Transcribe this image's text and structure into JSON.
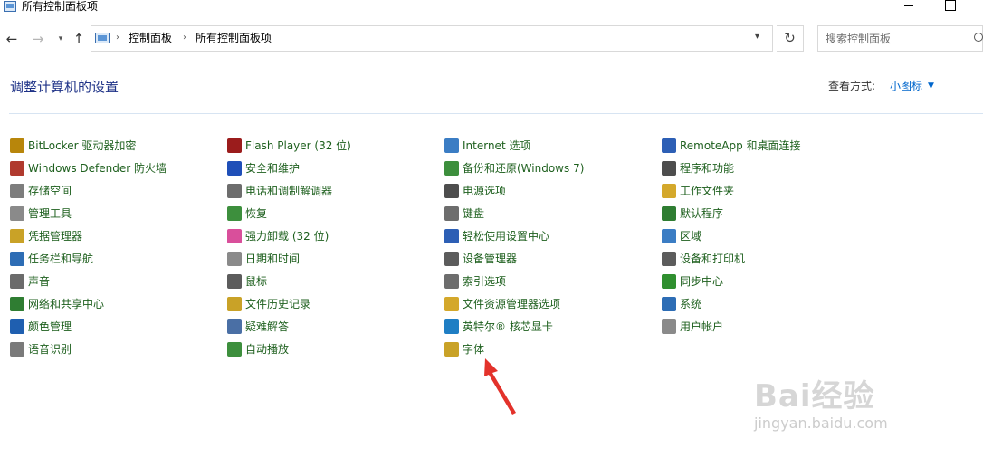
{
  "window": {
    "title": "所有控制面板项"
  },
  "nav": {
    "back": "←",
    "forward": "→",
    "recent": "▾",
    "up": "↑",
    "breadcrumb": [
      "控制面板",
      "所有控制面板项"
    ],
    "refresh": "↻",
    "search_placeholder": "搜索控制面板"
  },
  "header": {
    "title": "调整计算机的设置",
    "view_label": "查看方式:",
    "view_value": "小图标",
    "view_caret": "▼"
  },
  "columns": [
    [
      {
        "label": "BitLocker 驱动器加密",
        "icon": "key-icon",
        "color": "#b8860b"
      },
      {
        "label": "Windows Defender 防火墙",
        "icon": "firewall-icon",
        "color": "#b03a2e"
      },
      {
        "label": "存储空间",
        "icon": "storage-icon",
        "color": "#7d7d7d"
      },
      {
        "label": "管理工具",
        "icon": "tools-icon",
        "color": "#8a8a8a"
      },
      {
        "label": "凭据管理器",
        "icon": "vault-icon",
        "color": "#c9a227"
      },
      {
        "label": "任务栏和导航",
        "icon": "taskbar-icon",
        "color": "#2d6db5"
      },
      {
        "label": "声音",
        "icon": "speaker-icon",
        "color": "#6b6b6b"
      },
      {
        "label": "网络和共享中心",
        "icon": "network-icon",
        "color": "#2f7d32"
      },
      {
        "label": "颜色管理",
        "icon": "monitor-color-icon",
        "color": "#1f5fb0"
      },
      {
        "label": "语音识别",
        "icon": "microphone-icon",
        "color": "#7a7a7a"
      }
    ],
    [
      {
        "label": "Flash Player (32 位)",
        "icon": "flash-icon",
        "color": "#9b1c1c"
      },
      {
        "label": "安全和维护",
        "icon": "flag-icon",
        "color": "#1f4fb8"
      },
      {
        "label": "电话和调制解调器",
        "icon": "modem-icon",
        "color": "#6d6d6d"
      },
      {
        "label": "恢复",
        "icon": "recovery-icon",
        "color": "#3d8f3d"
      },
      {
        "label": "强力卸载 (32 位)",
        "icon": "uninstall-icon",
        "color": "#d94f9b"
      },
      {
        "label": "日期和时间",
        "icon": "clock-icon",
        "color": "#8a8a8a"
      },
      {
        "label": "鼠标",
        "icon": "mouse-icon",
        "color": "#5c5c5c"
      },
      {
        "label": "文件历史记录",
        "icon": "file-history-icon",
        "color": "#c9a227"
      },
      {
        "label": "疑难解答",
        "icon": "troubleshoot-icon",
        "color": "#4a6fa5"
      },
      {
        "label": "自动播放",
        "icon": "autoplay-icon",
        "color": "#3d8f3d"
      }
    ],
    [
      {
        "label": "Internet 选项",
        "icon": "globe-icon",
        "color": "#3b7dc4"
      },
      {
        "label": "备份和还原(Windows 7)",
        "icon": "backup-icon",
        "color": "#3d8f3d"
      },
      {
        "label": "电源选项",
        "icon": "power-icon",
        "color": "#4d4d4d"
      },
      {
        "label": "键盘",
        "icon": "keyboard-icon",
        "color": "#6d6d6d"
      },
      {
        "label": "轻松使用设置中心",
        "icon": "ease-of-access-icon",
        "color": "#2d5fb5"
      },
      {
        "label": "设备管理器",
        "icon": "device-manager-icon",
        "color": "#5c5c5c"
      },
      {
        "label": "索引选项",
        "icon": "index-search-icon",
        "color": "#6d6d6d"
      },
      {
        "label": "文件资源管理器选项",
        "icon": "folder-options-icon",
        "color": "#d4a82b"
      },
      {
        "label": "英特尔® 核芯显卡",
        "icon": "intel-graphics-icon",
        "color": "#1f7ec4"
      },
      {
        "label": "字体",
        "icon": "font-icon",
        "color": "#c9a227"
      }
    ],
    [
      {
        "label": "RemoteApp 和桌面连接",
        "icon": "remote-desktop-icon",
        "color": "#2d5fb5"
      },
      {
        "label": "程序和功能",
        "icon": "programs-icon",
        "color": "#4d4d4d"
      },
      {
        "label": "工作文件夹",
        "icon": "work-folders-icon",
        "color": "#d4a82b"
      },
      {
        "label": "默认程序",
        "icon": "default-programs-icon",
        "color": "#2f7d32"
      },
      {
        "label": "区域",
        "icon": "region-globe-icon",
        "color": "#3b7dc4"
      },
      {
        "label": "设备和打印机",
        "icon": "printer-icon",
        "color": "#5c5c5c"
      },
      {
        "label": "同步中心",
        "icon": "sync-icon",
        "color": "#2f8f2f"
      },
      {
        "label": "系统",
        "icon": "system-monitor-icon",
        "color": "#2d6db5"
      },
      {
        "label": "用户帐户",
        "icon": "users-icon",
        "color": "#8a8a8a"
      }
    ]
  ],
  "watermark": {
    "brand": "Bai经验",
    "url": "jingyan.baidu.com"
  },
  "colors": {
    "heading": "#1e3287",
    "item_text": "#1d5f1d",
    "link": "#0066cc",
    "arrow": "#e3322b"
  }
}
